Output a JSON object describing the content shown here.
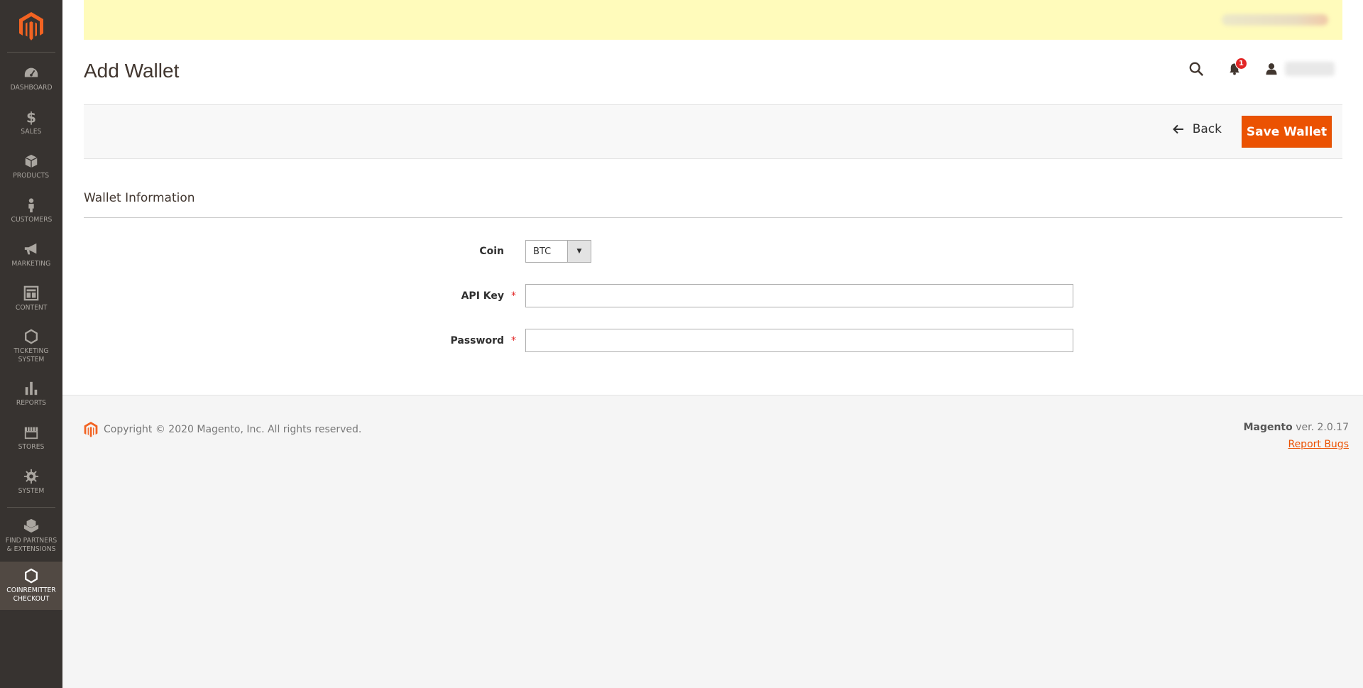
{
  "sidebar": {
    "items": [
      {
        "label": "DASHBOARD",
        "icon": "dashboard-icon"
      },
      {
        "label": "$ SALES",
        "icon": "dollar-icon"
      },
      {
        "label": "PRODUCTS",
        "icon": "box-icon"
      },
      {
        "label": "CUSTOMERS",
        "icon": "person-icon"
      },
      {
        "label": "MARKETING",
        "icon": "megaphone-icon"
      },
      {
        "label": "CONTENT",
        "icon": "layout-icon"
      },
      {
        "label": "TICKETING SYSTEM",
        "icon": "hexagon-icon"
      },
      {
        "label": "REPORTS",
        "icon": "bar-chart-icon"
      },
      {
        "label": "STORES",
        "icon": "storefront-icon"
      },
      {
        "label": "SYSTEM",
        "icon": "gear-icon"
      },
      {
        "label": "FIND PARTNERS & EXTENSIONS",
        "icon": "boxes-icon"
      },
      {
        "label": "COINREMITTER CHECKOUT",
        "icon": "hexagon-icon"
      }
    ]
  },
  "header": {
    "title": "Add Wallet",
    "notification_count": "1"
  },
  "actions": {
    "back_label": "Back",
    "save_label": "Save Wallet"
  },
  "section": {
    "title": "Wallet Information"
  },
  "form": {
    "coin_label": "Coin",
    "coin_value": "BTC",
    "api_key_label": "API Key",
    "api_key_value": "",
    "password_label": "Password",
    "password_value": "",
    "required_mark": "*"
  },
  "footer": {
    "copyright": "Copyright © 2020 Magento, Inc. All rights reserved.",
    "brand": "Magento",
    "version": " ver. 2.0.17",
    "report_bugs": "Report Bugs"
  },
  "colors": {
    "accent": "#eb5202",
    "sidebar_bg": "#373330",
    "notice_bg": "#fffbbb"
  }
}
